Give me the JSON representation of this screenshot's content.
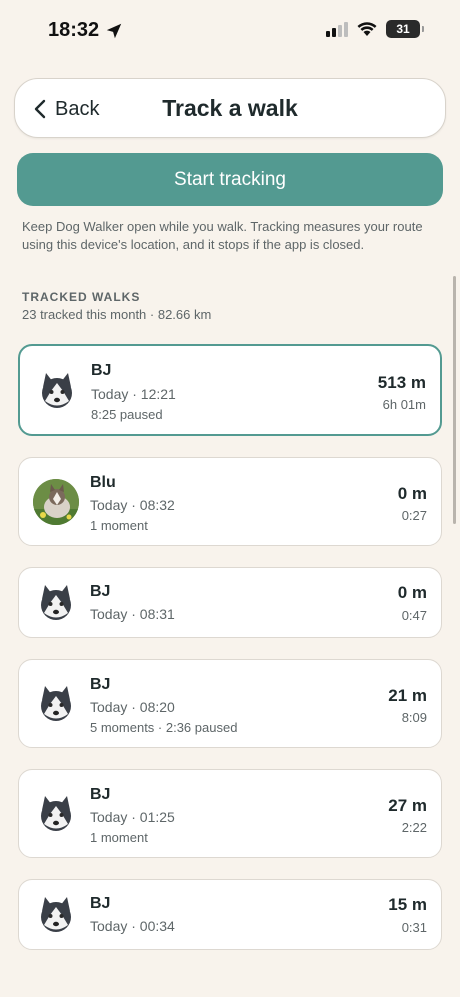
{
  "status_bar": {
    "time": "18:32",
    "battery": "31",
    "icons": [
      "location-arrow-icon",
      "cellular-signal-icon",
      "wifi-icon",
      "battery-icon"
    ]
  },
  "header": {
    "back_label": "Back",
    "title": "Track a walk"
  },
  "start_button": "Start tracking",
  "info_text": "Keep Dog Walker open while you walk. Tracking measures your route using this device's location, and it stops if the app is closed.",
  "section": {
    "title": "TRACKED WALKS",
    "summary": "23 tracked this month · 82.66 km"
  },
  "colors": {
    "accent": "#539a91",
    "background": "#f8f3ec"
  },
  "walks": [
    {
      "name": "BJ",
      "time": "Today · 12:21",
      "extra": "8:25 paused",
      "distance": "513 m",
      "duration": "6h 01m",
      "avatar": "husky-icon",
      "selected": true
    },
    {
      "name": "Blu",
      "time": "Today · 08:32",
      "extra": "1 moment",
      "distance": "0 m",
      "duration": "0:27",
      "avatar": "dog-photo",
      "selected": false
    },
    {
      "name": "BJ",
      "time": "Today · 08:31",
      "extra": "",
      "distance": "0 m",
      "duration": "0:47",
      "avatar": "husky-icon",
      "selected": false
    },
    {
      "name": "BJ",
      "time": "Today · 08:20",
      "extra": "5 moments · 2:36 paused",
      "distance": "21 m",
      "duration": "8:09",
      "avatar": "husky-icon",
      "selected": false
    },
    {
      "name": "BJ",
      "time": "Today · 01:25",
      "extra": "1 moment",
      "distance": "27 m",
      "duration": "2:22",
      "avatar": "husky-icon",
      "selected": false
    },
    {
      "name": "BJ",
      "time": "Today · 00:34",
      "extra": "",
      "distance": "15 m",
      "duration": "0:31",
      "avatar": "husky-icon",
      "selected": false
    }
  ]
}
